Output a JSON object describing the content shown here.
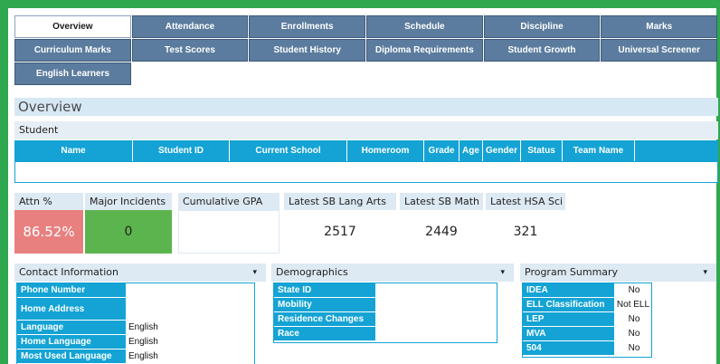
{
  "tabs": {
    "row1": [
      "Overview",
      "Attendance",
      "Enrollments",
      "Schedule",
      "Discipline",
      "Marks"
    ],
    "row2": [
      "Curriculum Marks",
      "Test Scores",
      "Student History",
      "Diploma Requirements",
      "Student Growth",
      "Universal Screener"
    ],
    "row3": [
      "English Learners"
    ]
  },
  "page": {
    "title": "Overview"
  },
  "student": {
    "section_label": "Student",
    "columns": [
      "Name",
      "Student ID",
      "Current School",
      "Homeroom",
      "Grade",
      "Age",
      "Gender",
      "Status",
      "Team Name"
    ]
  },
  "tiles": [
    {
      "label": "Attn %",
      "value": "86.52%",
      "color": "#e88080"
    },
    {
      "label": "Major Incidents",
      "value": "0",
      "color": "#5cb44e"
    },
    {
      "label": "Cumulative GPA",
      "value": ""
    },
    {
      "label": "Latest SB Lang Arts",
      "value": "2517"
    },
    {
      "label": "Latest SB Math",
      "value": "2449"
    },
    {
      "label": "Latest HSA Sci",
      "value": "321"
    }
  ],
  "contact": {
    "title": "Contact Information",
    "caret": "▾",
    "rows": [
      {
        "key": "Phone Number",
        "value": ""
      },
      {
        "key": "Home Address",
        "value": ""
      },
      {
        "key": "Language",
        "value": "English"
      },
      {
        "key": "Home Language",
        "value": "English"
      },
      {
        "key": "Most Used Language",
        "value": "English"
      }
    ]
  },
  "demographics": {
    "title": "Demographics",
    "caret": "▾",
    "rows": [
      {
        "key": "State ID",
        "value": ""
      },
      {
        "key": "Mobility",
        "value": ""
      },
      {
        "key": "Residence Changes",
        "value": ""
      },
      {
        "key": "Race",
        "value": ""
      }
    ]
  },
  "program": {
    "title": "Program Summary",
    "caret": "▾",
    "rows": [
      {
        "key": "IDEA",
        "value": "No"
      },
      {
        "key": "ELL Classification",
        "value": "Not ELL"
      },
      {
        "key": "LEP",
        "value": "No"
      },
      {
        "key": "MVA",
        "value": "No"
      },
      {
        "key": "504",
        "value": "No"
      }
    ]
  },
  "colors": {
    "frame": "#2fa84f",
    "tab": "#5b7c9e",
    "accent": "#14a3d4"
  }
}
